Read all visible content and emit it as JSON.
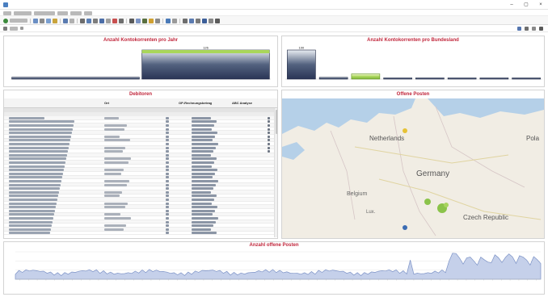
{
  "window": {
    "title": "",
    "controls": {
      "minimize": "–",
      "maximize": "▢",
      "close": "×"
    }
  },
  "panels": {
    "per_year": {
      "title": "Anzahl Kontokorrenten pro Jahr",
      "chart_data": {
        "type": "bar",
        "categories": [
          "",
          ""
        ],
        "values": [
          8,
          126
        ],
        "value_labels": [
          "",
          "126"
        ],
        "highlight_color": "#a9d65a",
        "bar_color": "#2a3556",
        "grid": false
      }
    },
    "per_state": {
      "title": "Anzahl Kontokorrenten pro Bundesland",
      "chart_data": {
        "type": "bar",
        "categories": [
          "",
          "",
          "",
          "",
          "",
          "",
          "",
          ""
        ],
        "values": [
          100,
          6,
          18,
          2,
          2,
          1,
          1,
          1
        ],
        "value_labels": [
          "100",
          "",
          "",
          "",
          "",
          "",
          "",
          ""
        ],
        "highlight_index": 2,
        "highlight_color": "#a9d65a",
        "bar_color": "#2a3556",
        "grid": false
      }
    },
    "debtors": {
      "title": "Debitoren",
      "columns": [
        "",
        "Ort",
        "",
        "OP-Rechnungsbetrag",
        "ABC Analyse"
      ],
      "total_row": {
        "count": "",
        "amount": ""
      },
      "rows": []
    },
    "map": {
      "title": "Offene Posten",
      "place_labels": [
        "Netherlands",
        "Germany",
        "Czech Republic",
        "Pola",
        "Belgium",
        "Lux."
      ]
    },
    "timeline": {
      "title": "Anzahl offene Posten",
      "chart_data": {
        "type": "area",
        "x_labels": [],
        "series_color": "#7c92c6",
        "fill_color": "#c5d0ea",
        "grid": true
      }
    }
  },
  "colors": {
    "title_red": "#c0253a",
    "dark_bar": "#2a3556",
    "highlight_green": "#a9d65a",
    "map_land": "#f1ede4",
    "map_water": "#b5d0e8",
    "pin_green": "#8bc34a",
    "pin_yellow": "#e6c235",
    "pin_blue": "#3b6cb3"
  }
}
